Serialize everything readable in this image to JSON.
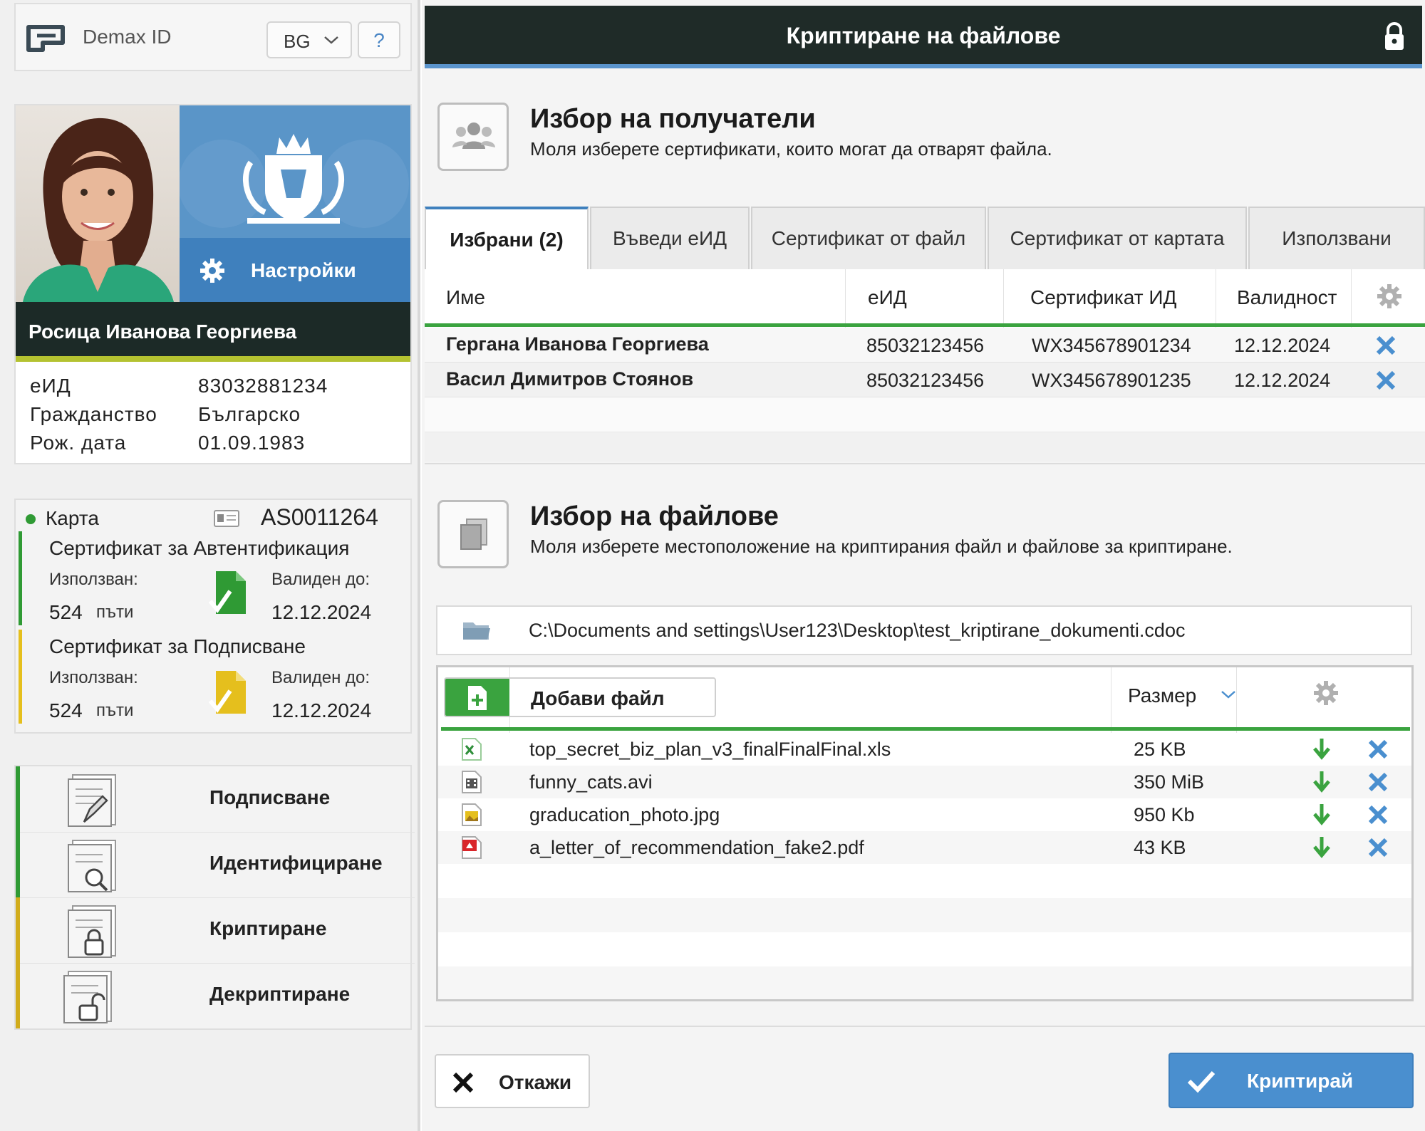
{
  "app": {
    "name": "Demax ID",
    "language": "BG",
    "help": "?"
  },
  "profile": {
    "settings_label": "Настройки",
    "name": "Росица Иванова Георгиева",
    "info": [
      {
        "label": "еИД",
        "value": "83032881234"
      },
      {
        "label": "Гражданство",
        "value": "Българско"
      },
      {
        "label": "Рож. дата",
        "value": "01.09.1983"
      }
    ]
  },
  "card": {
    "label": "Карта",
    "number": "AS0011264",
    "certs": [
      {
        "title": "Сертификат за Автентификация",
        "used_label": "Използван:",
        "used_count": "524",
        "used_unit": "пъти",
        "valid_label": "Валиден до:",
        "valid_date": "12.12.2024",
        "color": "#2f9a34"
      },
      {
        "title": "Сертификат за Подписване",
        "used_label": "Използван:",
        "used_count": "524",
        "used_unit": "пъти",
        "valid_label": "Валиден до:",
        "valid_date": "12.12.2024",
        "color": "#e5bf1d"
      }
    ]
  },
  "actions": [
    {
      "label": "Подписване",
      "icon": "sign-document-icon"
    },
    {
      "label": "Идентифициране",
      "icon": "identify-document-icon"
    },
    {
      "label": "Криптиране",
      "icon": "encrypt-document-icon"
    },
    {
      "label": "Декриптиране",
      "icon": "decrypt-document-icon"
    }
  ],
  "window": {
    "title": "Криптиране на файлове"
  },
  "recipients": {
    "title": "Избор на получатели",
    "description": "Моля изберете сертификати, които могат да отварят файла.",
    "tabs": [
      "Избрани (2)",
      "Въведи еИД",
      "Сертификат от файл",
      "Сертификат от картата",
      "Използвани"
    ],
    "columns": [
      "Име",
      "еИД",
      "Сертификат ИД",
      "Валидност"
    ],
    "rows": [
      {
        "name": "Гергана Иванова Георгиева",
        "eid": "85032123456",
        "cert_id": "WX345678901234",
        "validity": "12.12.2024"
      },
      {
        "name": "Васил Димитров Стоянов",
        "eid": "85032123456",
        "cert_id": "WX345678901235",
        "validity": "12.12.2024"
      }
    ]
  },
  "files": {
    "title": "Избор на файлове",
    "description": "Моля изберете местоположение на криптирания файл и файлове за криптиране.",
    "path": "C:\\Documents and settings\\User123\\Desktop\\test_kriptirane_dokumenti.cdoc",
    "add_label": "Добави файл",
    "size_header": "Размер",
    "rows": [
      {
        "name": "top_secret_biz_plan_v3_finalFinalFinal.xls",
        "size": "25 KB",
        "icon": "excel-file-icon"
      },
      {
        "name": "funny_cats.avi",
        "size": "350 MiB",
        "icon": "video-file-icon"
      },
      {
        "name": "graducation_photo.jpg",
        "size": "950 Kb",
        "icon": "image-file-icon"
      },
      {
        "name": "a_letter_of_recommendation_fake2.pdf",
        "size": "43 KB",
        "icon": "pdf-file-icon"
      }
    ]
  },
  "buttons": {
    "cancel": "Откажи",
    "encrypt": "Криптирай"
  },
  "colors": {
    "accent_blue": "#4a8fcf",
    "accent_green": "#3aa33f",
    "accent_yellow": "#e5bf1d",
    "title_bar": "#1f2b28"
  }
}
